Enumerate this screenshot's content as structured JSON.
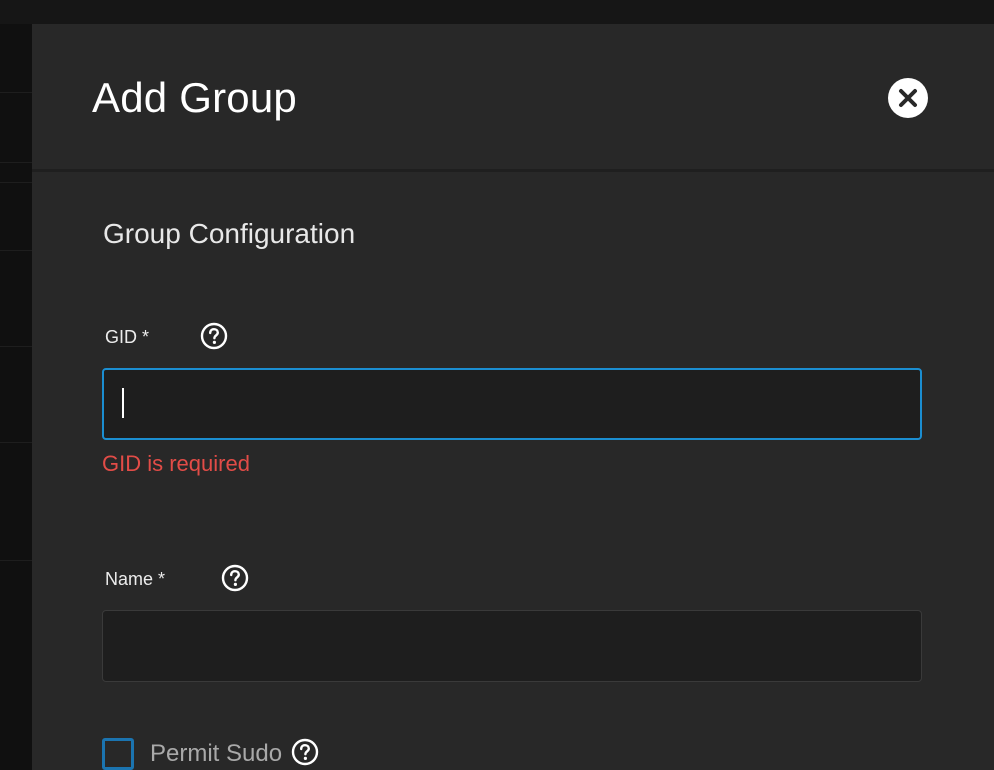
{
  "dialog": {
    "title": "Add Group",
    "close_icon": "close-circle-icon"
  },
  "section": {
    "title": "Group Configuration"
  },
  "fields": {
    "gid": {
      "label": "GID *",
      "value": "",
      "placeholder": "",
      "error": "GID is required",
      "help_icon": "help-circle-icon"
    },
    "name": {
      "label": "Name *",
      "value": "",
      "placeholder": "",
      "help_icon": "help-circle-icon"
    },
    "permit_sudo": {
      "label": "Permit Sudo",
      "checked": false,
      "help_icon": "help-circle-icon"
    }
  },
  "colors": {
    "accent": "#1b8ed1",
    "error": "#e24c47",
    "panel_bg": "#282828",
    "input_bg": "#1e1e1e"
  }
}
